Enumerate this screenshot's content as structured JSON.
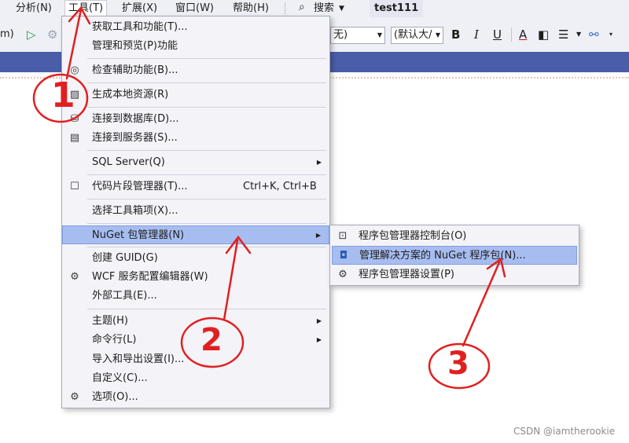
{
  "menubar": {
    "items": [
      "分析(N)",
      "工具(T)",
      "扩展(X)",
      "窗口(W)",
      "帮助(H)"
    ],
    "search_label": "搜索",
    "project_name": "test111"
  },
  "toolbar": {
    "left_text": "m)",
    "combo1_value": "无)",
    "combo2_value": "(默认大/",
    "bold": "B",
    "italic": "I",
    "underline": "U",
    "font_color": "A"
  },
  "tools_menu": {
    "items": [
      {
        "label": "获取工具和功能(T)..."
      },
      {
        "label": "管理和预览(P)功能"
      },
      {
        "label": "检查辅助功能(B)..."
      },
      {
        "label": "生成本地资源(R)"
      },
      {
        "label": "连接到数据库(D)..."
      },
      {
        "label": "连接到服务器(S)..."
      },
      {
        "label": "SQL Server(Q)"
      },
      {
        "label": "代码片段管理器(T)...",
        "shortcut": "Ctrl+K, Ctrl+B"
      },
      {
        "label": "选择工具箱项(X)..."
      },
      {
        "label": "NuGet 包管理器(N)"
      },
      {
        "label": "创建 GUID(G)"
      },
      {
        "label": "WCF 服务配置编辑器(W)"
      },
      {
        "label": "外部工具(E)..."
      },
      {
        "label": "主题(H)"
      },
      {
        "label": "命令行(L)"
      },
      {
        "label": "导入和导出设置(I)..."
      },
      {
        "label": "自定义(C)..."
      },
      {
        "label": "选项(O)..."
      }
    ]
  },
  "nuget_submenu": {
    "items": [
      {
        "label": "程序包管理器控制台(O)"
      },
      {
        "label": "管理解决方案的 NuGet 程序包(N)..."
      },
      {
        "label": "程序包管理器设置(P)"
      }
    ]
  },
  "annotations": {
    "step1": "1",
    "step2": "2",
    "step3": "3",
    "color": "#e02020"
  },
  "watermark": "CSDN @iamtherookie",
  "colors": {
    "highlight": "#a7bdf0",
    "tabstrip": "#4a5da8",
    "menu_bg": "#f3f3f8"
  }
}
